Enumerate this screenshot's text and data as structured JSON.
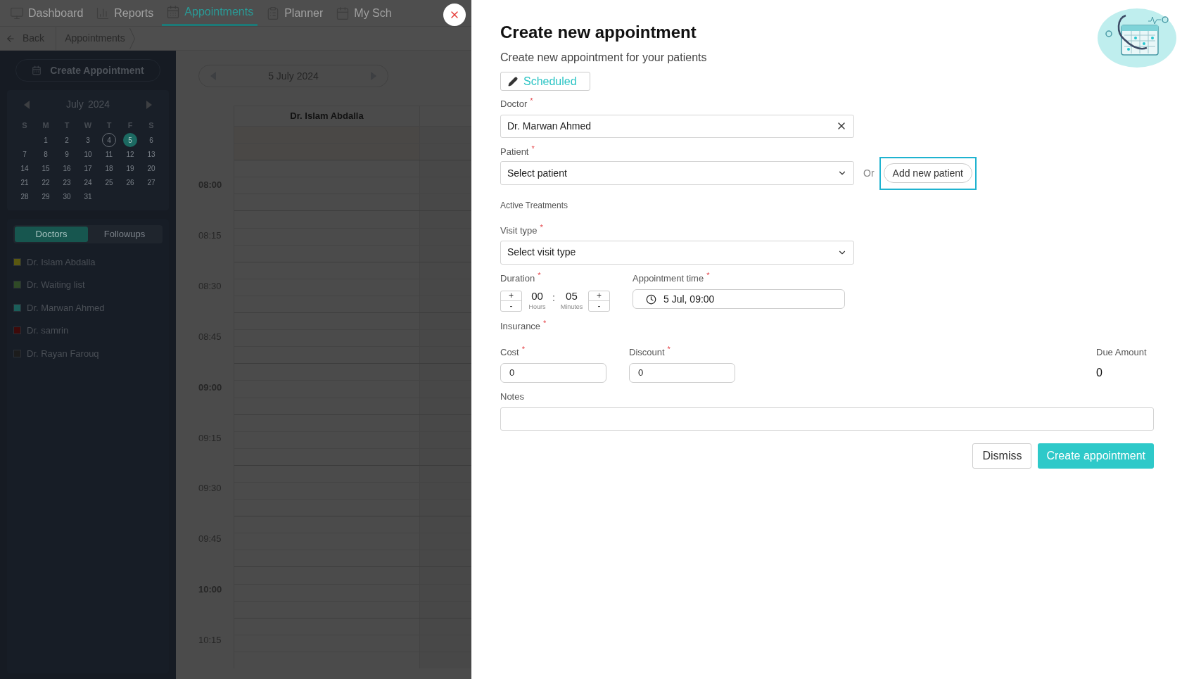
{
  "nav_tabs": [
    {
      "label": "Dashboard",
      "selected": false
    },
    {
      "label": "Reports",
      "selected": false
    },
    {
      "label": "Appointments",
      "selected": true
    },
    {
      "label": "Planner",
      "selected": false
    },
    {
      "label": "My Sch",
      "selected": false
    }
  ],
  "breadcrumb": {
    "back": "Back",
    "current": "Appointments"
  },
  "sidebar": {
    "create_button": "Create Appointment",
    "calendar": {
      "month": "July",
      "year": "2024",
      "weekdays": [
        "S",
        "M",
        "T",
        "W",
        "T",
        "F",
        "S"
      ],
      "days": [
        {
          "label": "1",
          "selected": false,
          "today": false
        },
        {
          "label": "2",
          "selected": false,
          "today": false
        },
        {
          "label": "3",
          "selected": false,
          "today": false
        },
        {
          "label": "4",
          "selected": false,
          "today": true
        },
        {
          "label": "5",
          "selected": true,
          "today": false
        },
        {
          "label": "6",
          "selected": false,
          "today": false
        },
        {
          "label": "7",
          "selected": false,
          "today": false
        },
        {
          "label": "8",
          "selected": false,
          "today": false
        },
        {
          "label": "9",
          "selected": false,
          "today": false
        },
        {
          "label": "10",
          "selected": false,
          "today": false
        },
        {
          "label": "11",
          "selected": false,
          "today": false
        },
        {
          "label": "12",
          "selected": false,
          "today": false
        },
        {
          "label": "13",
          "selected": false,
          "today": false
        },
        {
          "label": "14",
          "selected": false,
          "today": false
        },
        {
          "label": "15",
          "selected": false,
          "today": false
        },
        {
          "label": "16",
          "selected": false,
          "today": false
        },
        {
          "label": "17",
          "selected": false,
          "today": false
        },
        {
          "label": "18",
          "selected": false,
          "today": false
        },
        {
          "label": "19",
          "selected": false,
          "today": false
        },
        {
          "label": "20",
          "selected": false,
          "today": false
        },
        {
          "label": "21",
          "selected": false,
          "today": false
        },
        {
          "label": "22",
          "selected": false,
          "today": false
        },
        {
          "label": "23",
          "selected": false,
          "today": false
        },
        {
          "label": "24",
          "selected": false,
          "today": false
        },
        {
          "label": "25",
          "selected": false,
          "today": false
        },
        {
          "label": "26",
          "selected": false,
          "today": false
        },
        {
          "label": "27",
          "selected": false,
          "today": false
        },
        {
          "label": "28",
          "selected": false,
          "today": false
        },
        {
          "label": "29",
          "selected": false,
          "today": false
        },
        {
          "label": "30",
          "selected": false,
          "today": false
        },
        {
          "label": "31",
          "selected": false,
          "today": false
        }
      ]
    },
    "tabs": [
      {
        "label": "Doctors",
        "selected": true
      },
      {
        "label": "Followups",
        "selected": false
      }
    ],
    "doctors": [
      {
        "name": "Dr. Islam Abdalla",
        "color": "#5a5810"
      },
      {
        "name": "Dr. Waiting list",
        "color": "#2f4a26"
      },
      {
        "name": "Dr. Marwan Ahmed",
        "color": "#1b5e5a"
      },
      {
        "name": "Dr. samrin",
        "color": "#3e0a0a"
      },
      {
        "name": "Dr. Rayan Farouq",
        "color": "#1c1c1c"
      }
    ]
  },
  "schedule": {
    "date": "5 July 2024",
    "columns": [
      "Dr. Islam Abdalla"
    ],
    "times": [
      {
        "label": "08:00",
        "major": true
      },
      {
        "label": "08:15",
        "major": false
      },
      {
        "label": "08:30",
        "major": false
      },
      {
        "label": "08:45",
        "major": false
      },
      {
        "label": "09:00",
        "major": true
      },
      {
        "label": "09:15",
        "major": false
      },
      {
        "label": "09:30",
        "major": false
      },
      {
        "label": "09:45",
        "major": false
      },
      {
        "label": "10:00",
        "major": true
      },
      {
        "label": "10:15",
        "major": false
      }
    ]
  },
  "dialog": {
    "title": "Create new appointment",
    "subtitle": "Create new appointment for your patients",
    "status": {
      "label": "Scheduled"
    },
    "doctor": {
      "label": "Doctor",
      "required_mark": "*",
      "value": "Dr. Marwan Ahmed"
    },
    "patient": {
      "label": "Patient",
      "required_mark": "*",
      "placeholder": "Select patient"
    },
    "or_text": "Or",
    "add_patient_button": {
      "label": "Add new patient",
      "focused": true
    },
    "active_treatments": "Active Treatments",
    "visit_type": {
      "label": "Visit type",
      "required_mark": "*",
      "placeholder": "Select visit type"
    },
    "duration": {
      "label": "Duration",
      "required_mark": "*",
      "hours": "00",
      "hours_label": "Hours",
      "separator": ":",
      "minutes": "05",
      "minutes_label": "Minutes",
      "plus": "+",
      "minus": "-"
    },
    "appointment_time": {
      "label": "Appointment time",
      "required_mark": "*",
      "value": "5 Jul, 09:00"
    },
    "insurance": {
      "label": "Insurance",
      "required_mark": "*"
    },
    "cost": {
      "label": "Cost",
      "required_mark": "*",
      "value": "0"
    },
    "discount": {
      "label": "Discount",
      "required_mark": "*",
      "value": "0"
    },
    "due_amount": {
      "label": "Due Amount",
      "value": "0"
    },
    "notes": {
      "label": "Notes"
    },
    "dismiss_button": "Dismiss",
    "create_button": "Create appointment"
  }
}
